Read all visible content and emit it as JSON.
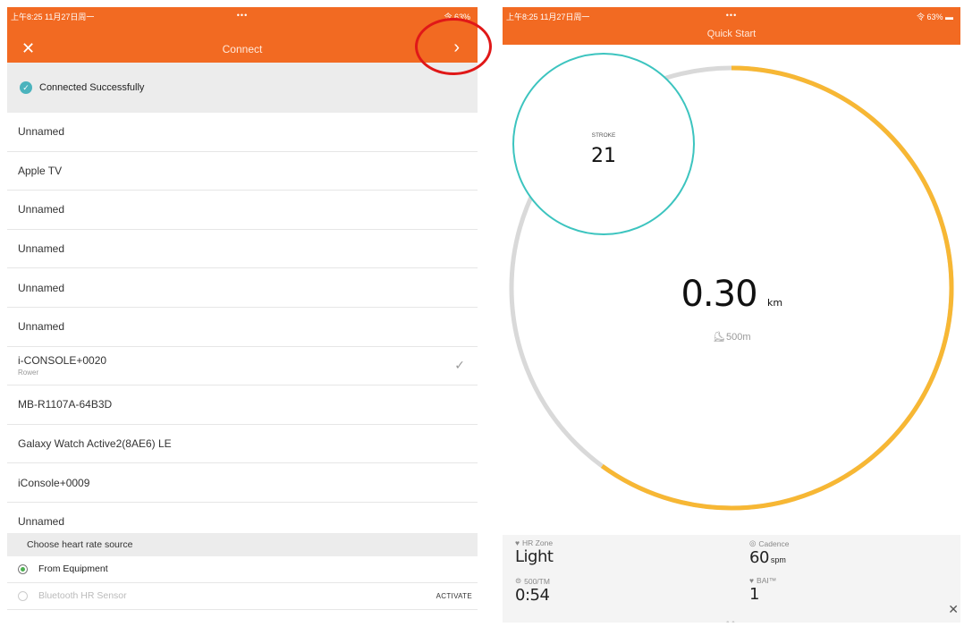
{
  "left": {
    "status": {
      "time": "上午8:25  11月27日周一",
      "dots": "•••",
      "right": "令 63%"
    },
    "nav": {
      "title": "Connect",
      "close": "✕",
      "next": "›"
    },
    "banner": {
      "text": "Connected Successfully",
      "check": "✓"
    },
    "devices": [
      {
        "name": "Unnamed",
        "sub": "",
        "selected": false
      },
      {
        "name": "Apple TV",
        "sub": "",
        "selected": false
      },
      {
        "name": "Unnamed",
        "sub": "",
        "selected": false
      },
      {
        "name": "Unnamed",
        "sub": "",
        "selected": false
      },
      {
        "name": "Unnamed",
        "sub": "",
        "selected": false
      },
      {
        "name": "Unnamed",
        "sub": "",
        "selected": false
      },
      {
        "name": "i-CONSOLE+0020",
        "sub": "Rower",
        "selected": true
      },
      {
        "name": "MB-R1107A-64B3D",
        "sub": "",
        "selected": false
      },
      {
        "name": "Galaxy Watch Active2(8AE6) LE",
        "sub": "",
        "selected": false
      },
      {
        "name": "iConsole+0009",
        "sub": "",
        "selected": false
      },
      {
        "name": "Unnamed",
        "sub": "",
        "selected": false
      }
    ],
    "hr": {
      "header": "Choose heart rate source",
      "options": [
        {
          "label": "From Equipment",
          "selected": true
        },
        {
          "label": "Bluetooth HR Sensor",
          "selected": false,
          "action": "ACTIVATE"
        }
      ]
    }
  },
  "right": {
    "status": {
      "time": "上午8:25  11月27日周一",
      "dots": "•••",
      "right": "令 63% ▬"
    },
    "nav": {
      "title": "Quick Start"
    },
    "gauge": {
      "distance_value": "0.30",
      "distance_unit": "km",
      "target": "500m",
      "progress": 0.6,
      "stroke_label": "STROKE",
      "stroke_value": "21",
      "colors": {
        "progress": "#f7b734",
        "track": "#d9d9d9",
        "stroke_ring": "#3cc4bf"
      }
    },
    "stats": [
      {
        "label": "HR Zone",
        "value": "Light",
        "unit": "",
        "icon": "heart-icon"
      },
      {
        "label": "Cadence",
        "value": "60",
        "unit": "spm",
        "icon": "cadence-icon"
      },
      {
        "label": "500/TM",
        "value": "0:54",
        "unit": "",
        "icon": "pace-icon"
      },
      {
        "label": "BAI™",
        "value": "1",
        "unit": "",
        "icon": "heart-icon"
      }
    ],
    "page_dots": "• •"
  },
  "colors": {
    "brand": "#f26a22",
    "highlight": "#e01818"
  }
}
